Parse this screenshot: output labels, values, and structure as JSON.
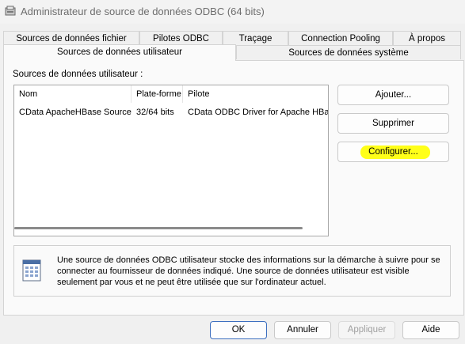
{
  "window": {
    "title": "Administrateur de source de données ODBC (64 bits)"
  },
  "tabs": {
    "row1": [
      "Sources de données fichier",
      "Pilotes ODBC",
      "Traçage",
      "Connection Pooling",
      "À propos"
    ],
    "row2": [
      "Sources de données utilisateur",
      "Sources de données système"
    ],
    "active": "Sources de données utilisateur"
  },
  "list": {
    "label": "Sources de données utilisateur :",
    "columns": [
      "Nom",
      "Plate-forme",
      "Pilote"
    ],
    "rows": [
      {
        "nom": "CData ApacheHBase Source",
        "plateforme": "32/64 bits",
        "pilote": "CData ODBC Driver for Apache HBas"
      }
    ]
  },
  "actions": {
    "add": "Ajouter...",
    "remove": "Supprimer",
    "configure": "Configurer..."
  },
  "info": {
    "text": "Une source de données ODBC utilisateur stocke des informations sur la démarche à suivre pour se connecter au fournisseur de données indiqué.   Une source de données utilisateur est visible seulement par vous et ne peut être utilisée que sur l'ordinateur actuel."
  },
  "footer": {
    "ok": "OK",
    "cancel": "Annuler",
    "apply": "Appliquer",
    "help": "Aide"
  },
  "colors": {
    "highlight": "#ffff00",
    "accent": "#3c6ebf"
  }
}
